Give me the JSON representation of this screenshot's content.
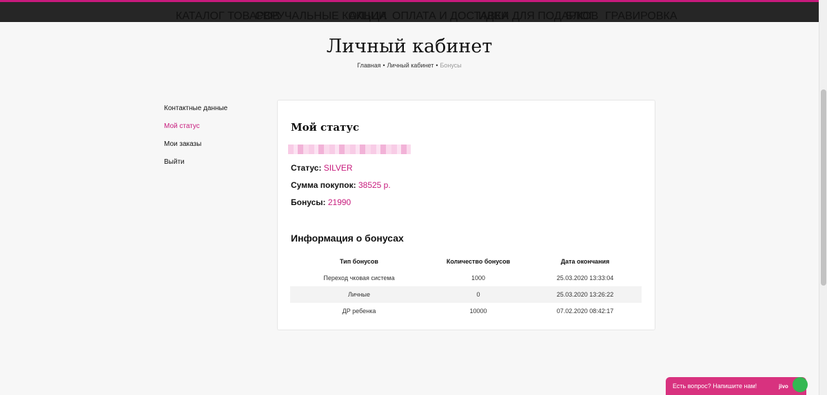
{
  "nav": {
    "items": [
      "КАТАЛОГ ТОВАРОВ",
      "СВРУЧАЛЬНЫЕ КОЛЬЦА",
      "АКЦИИ",
      "ОПЛАТА И ДОСТАВКА",
      "ИДЕИ ДЛЯ ПОДАРКОВ",
      "БЛОГ",
      "ГРАВИРОВКА"
    ]
  },
  "page": {
    "title": "Личный кабинет",
    "breadcrumb": [
      "Главная",
      "Личный кабинет",
      "Бонусы"
    ],
    "separator": "•"
  },
  "sidebar": {
    "items": [
      "Контактные данные",
      "Мой статус",
      "Мои заказы",
      "Выйти"
    ],
    "active_index": 1
  },
  "status": {
    "title": "Мой статус",
    "status_label": "Статус:",
    "status_value": "SILVER",
    "sum_label": "Сумма покупок:",
    "sum_value": "38525 р.",
    "bonus_label": "Бонусы:",
    "bonus_value": "21990"
  },
  "bonus_info": {
    "title": "Информация о бонусах",
    "headers": [
      "Тип бонусов",
      "Количество бонусов",
      "Дата окончания"
    ],
    "rows": [
      [
        "Переход чковая система",
        "1000",
        "25.03.2020 13:33:04"
      ],
      [
        "Личные",
        "0",
        "25.03.2020 13:26:22"
      ],
      [
        "ДР ребенка",
        "10000",
        "07.02.2020 08:42:17"
      ]
    ]
  },
  "chat": {
    "label": "Есть вопрос? Напишите нам!",
    "brand": "jivo"
  },
  "colors": {
    "accent": "#c71a7c",
    "topbar": "#262626",
    "chat": "#d8327f",
    "chat_status": "#34b852"
  }
}
